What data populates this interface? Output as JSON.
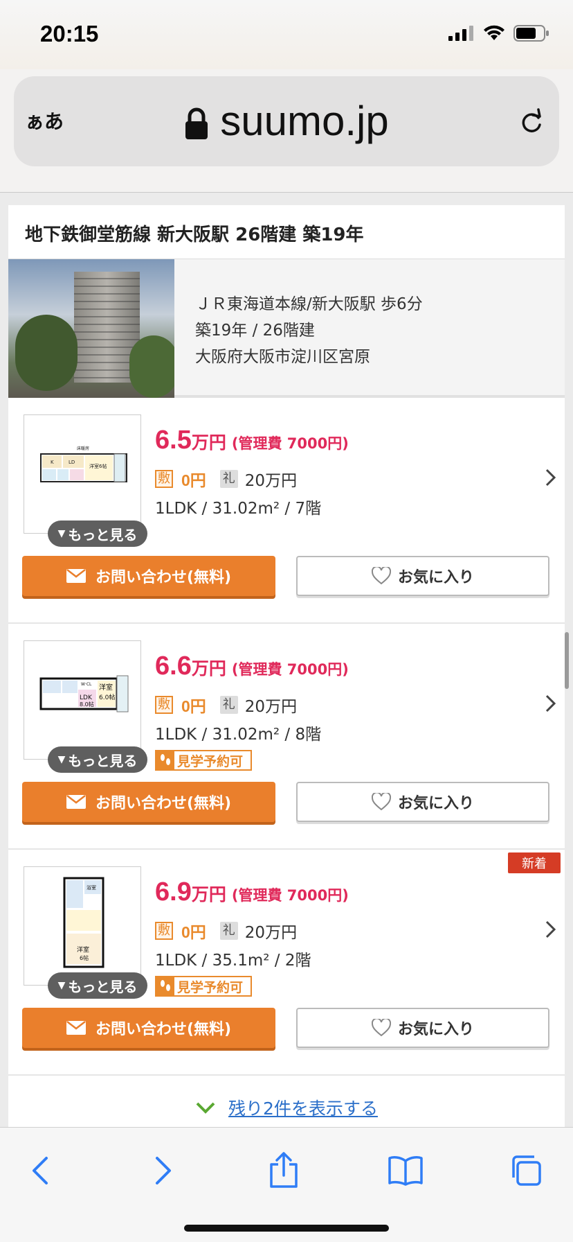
{
  "status_bar": {
    "time": "20:15"
  },
  "browser": {
    "text_size_label": "ぁあ",
    "url": "suumo.jp"
  },
  "building": {
    "header": "地下鉄御堂筋線 新大阪駅 26階建 築19年",
    "access": "ＪＲ東海道本線/新大阪駅 歩6分",
    "age_floors": "築19年 / 26階建",
    "address": "大阪府大阪市淀川区宮原"
  },
  "labels": {
    "more": "もっと見る",
    "deposit_badge": "敷",
    "key_money_badge": "礼",
    "inquiry": "お問い合わせ(無料)",
    "favorite": "お気に入り",
    "tour": "見学予約可",
    "new": "新着",
    "show_remaining": "残り2件を表示する"
  },
  "listings": [
    {
      "price": "6.5",
      "unit": "万円",
      "mgmt_fee": "(管理費 7000円)",
      "deposit": "0円",
      "key_money": "20万円",
      "spec": "1LDK /  31.02m² /  7階"
    },
    {
      "price": "6.6",
      "unit": "万円",
      "mgmt_fee": "(管理費 7000円)",
      "deposit": "0円",
      "key_money": "20万円",
      "spec": "1LDK /  31.02m² /  8階"
    },
    {
      "price": "6.9",
      "unit": "万円",
      "mgmt_fee": "(管理費 7000円)",
      "deposit": "0円",
      "key_money": "20万円",
      "spec": "1LDK /  35.1m² /  2階"
    }
  ],
  "colors": {
    "price": "#e0295a",
    "accent_orange": "#ea7f2c",
    "link_blue": "#2b6fc9",
    "new_badge": "#d53c25"
  }
}
